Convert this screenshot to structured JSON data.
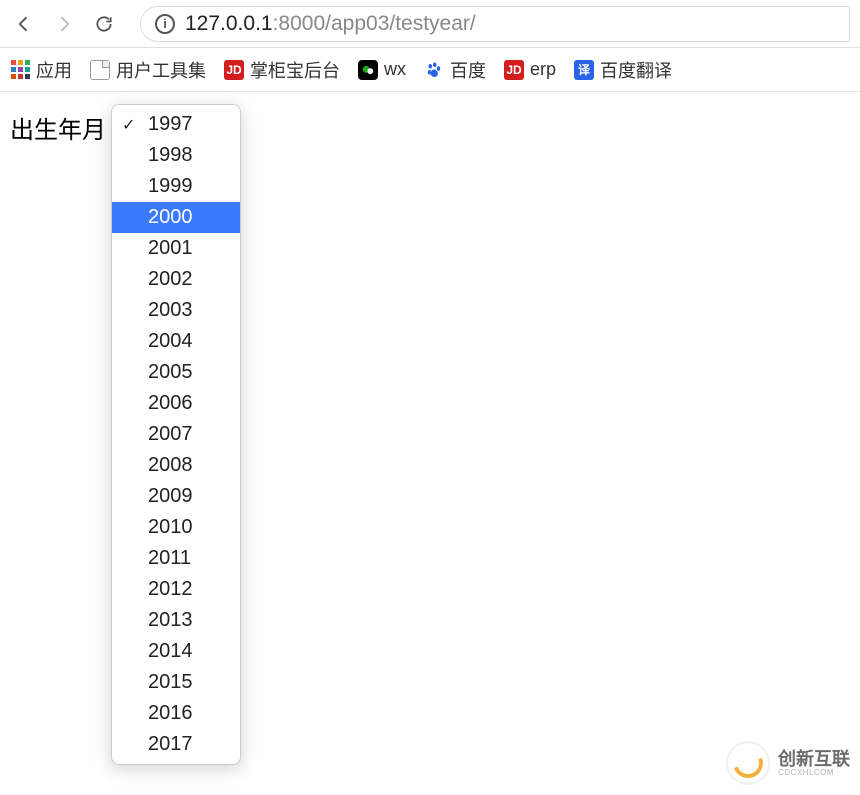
{
  "toolbar": {
    "url_host": "127.0.0.1",
    "url_path": ":8000/app03/testyear/"
  },
  "bookmarks": {
    "apps": "应用",
    "user_tools": "用户工具集",
    "shopkeeper": "掌柜宝后台",
    "wx": "wx",
    "baidu": "百度",
    "erp": "erp",
    "baidu_translate": "百度翻译",
    "jd_label": "JD",
    "translate_label": "译"
  },
  "page": {
    "label": "出生年月"
  },
  "dropdown": {
    "selected": "1997",
    "highlighted": "2000",
    "options": [
      "1997",
      "1998",
      "1999",
      "2000",
      "2001",
      "2002",
      "2003",
      "2004",
      "2005",
      "2006",
      "2007",
      "2008",
      "2009",
      "2010",
      "2011",
      "2012",
      "2013",
      "2014",
      "2015",
      "2016",
      "2017"
    ]
  },
  "watermark": {
    "brand": "创新互联",
    "sub": "CDCXHLCOM"
  }
}
